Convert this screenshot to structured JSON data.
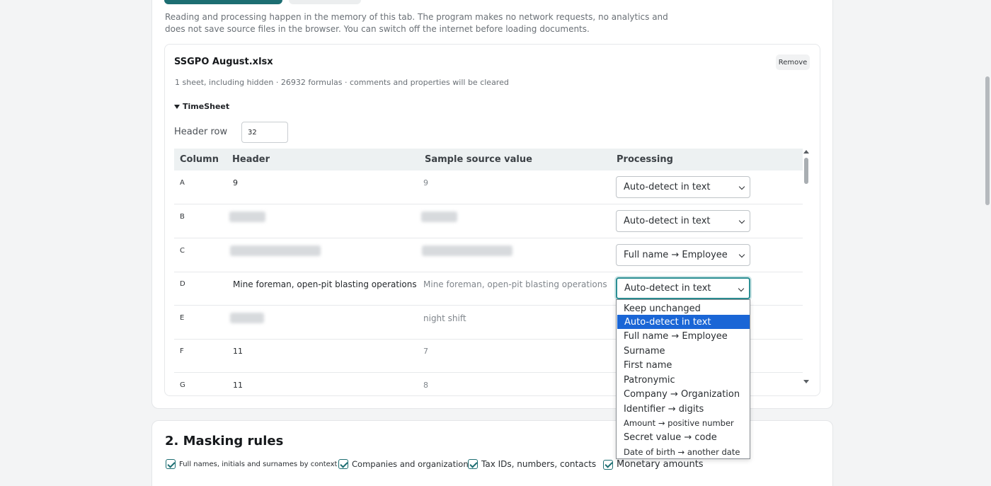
{
  "privacy_text": "Reading and processing happen in the memory of this tab. The program makes no network requests, no analytics and does not save source files in the browser. You can switch off the internet before loading documents.",
  "file": {
    "name": "SSGPO August.xlsx",
    "remove_label": "Remove",
    "meta": "1 sheet, including hidden · 26932 formulas · comments and properties will be cleared"
  },
  "sheet": {
    "name": "TimeSheet",
    "header_row_label": "Header row",
    "header_row_value": "32"
  },
  "table": {
    "columns": [
      "Column",
      "Header",
      "Sample source value",
      "Processing"
    ],
    "rows": [
      {
        "col": "A",
        "header": "9",
        "sample": "9",
        "processing": "Auto-detect in text"
      },
      {
        "col": "B",
        "header": "",
        "sample": "",
        "processing": "Auto-detect in text"
      },
      {
        "col": "C",
        "header": "",
        "sample": "",
        "processing": "Full name → Employee"
      },
      {
        "col": "D",
        "header": "Mine foreman, open-pit blasting operations",
        "sample": "Mine foreman, open-pit blasting operations",
        "processing": "Auto-detect in text"
      },
      {
        "col": "E",
        "header": "",
        "sample": "night shift",
        "processing": ""
      },
      {
        "col": "F",
        "header": "11",
        "sample": "7",
        "processing": ""
      },
      {
        "col": "G",
        "header": "11",
        "sample": "8",
        "processing": ""
      }
    ]
  },
  "dropdown": {
    "options": [
      "Keep unchanged",
      "Auto-detect in text",
      "Full name → Employee",
      "Surname",
      "First name",
      "Patronymic",
      "Company → Organization",
      "Identifier → digits",
      "Amount → positive number",
      "Secret value → code",
      "Date of birth → another date"
    ],
    "selected": "Auto-detect in text"
  },
  "masking": {
    "title": "2. Masking rules",
    "rules": [
      {
        "label": "Full names, initials and surnames by context",
        "checked": true
      },
      {
        "label": "Companies and organizations",
        "checked": true
      },
      {
        "label": "Tax IDs, numbers, contacts",
        "checked": true
      },
      {
        "label": "Monetary amounts",
        "checked": true
      }
    ]
  },
  "colors": {
    "accent": "#1d6e72",
    "selection": "#1a66d6"
  }
}
